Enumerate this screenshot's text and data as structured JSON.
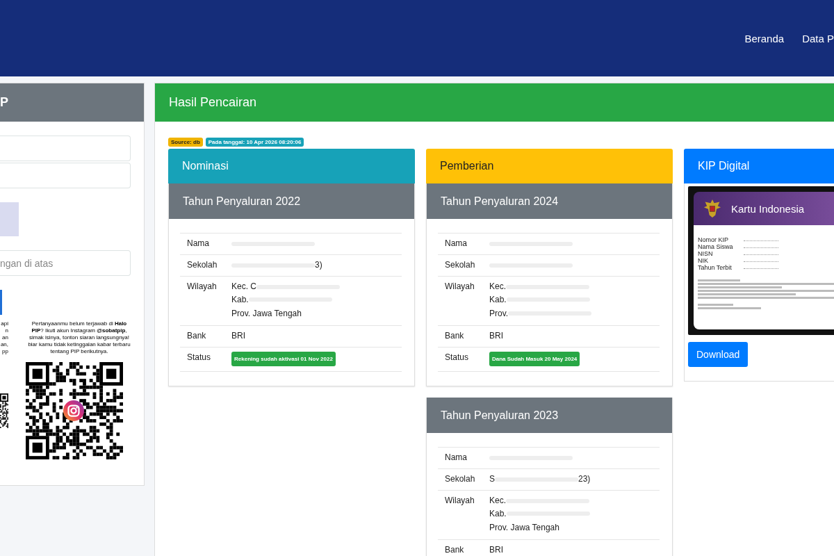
{
  "navbar": {
    "links": [
      "Beranda",
      "Data P"
    ]
  },
  "left_panel": {
    "title": "P",
    "inputs": [
      {
        "kind": "input"
      },
      {
        "kind": "input"
      },
      {
        "kind": "captcha"
      },
      {
        "kind": "input",
        "placeholder": "ngan di atas"
      }
    ],
    "left_text_lines": [
      "api",
      "n",
      "an",
      "an,",
      "pp"
    ],
    "right_text": "Pertanyaanmu belum terjawab di **Halo PIP**? Ikuti akun Instagram **@sobatpip**, simak isinya, tonton siaran langsungnya! biar kamu tidak ketinggalan kabar terbaru tentang PIP berikutnya."
  },
  "results": {
    "title": "Hasil Pencairan",
    "badges": [
      {
        "text": "Source: db",
        "color": "#f0b400"
      },
      {
        "text": "Pada tanggal: 10 Apr 2026 08:20:06",
        "color": "#17a2b8"
      }
    ],
    "columns": [
      {
        "kind": "table",
        "title": "Nominasi",
        "color": "#17a2b8",
        "cards": [
          {
            "title": "Tahun Penyaluran 2022",
            "rows": [
              {
                "label": "Nama",
                "lines": [
                  [
                    {
                      "kind": "blur"
                    }
                  ]
                ]
              },
              {
                "label": "Sekolah",
                "lines": [
                  [
                    {
                      "kind": "blur"
                    },
                    {
                      "kind": "text",
                      "text": "3)"
                    }
                  ]
                ]
              },
              {
                "label": "Wilayah",
                "lines": [
                  [
                    {
                      "kind": "text",
                      "text": "Kec. C"
                    },
                    {
                      "kind": "blur"
                    }
                  ],
                  [
                    {
                      "kind": "text",
                      "text": "Kab. "
                    },
                    {
                      "kind": "blur"
                    }
                  ],
                  [
                    {
                      "kind": "text",
                      "text": "Prov. Jawa Tengah"
                    }
                  ]
                ]
              },
              {
                "label": "Bank",
                "lines": [
                  [
                    {
                      "kind": "text",
                      "text": "BRI"
                    }
                  ]
                ]
              },
              {
                "label": "Status",
                "lines": [
                  [
                    {
                      "kind": "badge",
                      "text": "Rekening sudah aktivasi 01 Nov 2022"
                    }
                  ]
                ]
              }
            ]
          }
        ]
      },
      {
        "kind": "table",
        "title": "Pemberian",
        "color": "#ffc107",
        "cards": [
          {
            "title": "Tahun Penyaluran 2024",
            "rows": [
              {
                "label": "Nama",
                "lines": [
                  [
                    {
                      "kind": "blur"
                    }
                  ]
                ]
              },
              {
                "label": "Sekolah",
                "lines": [
                  [
                    {
                      "kind": "blur"
                    }
                  ]
                ]
              },
              {
                "label": "Wilayah",
                "lines": [
                  [
                    {
                      "kind": "text",
                      "text": "Kec. "
                    },
                    {
                      "kind": "blur"
                    }
                  ],
                  [
                    {
                      "kind": "text",
                      "text": "Kab. "
                    },
                    {
                      "kind": "blur"
                    }
                  ],
                  [
                    {
                      "kind": "text",
                      "text": "Prov. "
                    },
                    {
                      "kind": "blur"
                    }
                  ]
                ]
              },
              {
                "label": "Bank",
                "lines": [
                  [
                    {
                      "kind": "text",
                      "text": "BRI"
                    }
                  ]
                ]
              },
              {
                "label": "Status",
                "lines": [
                  [
                    {
                      "kind": "badge",
                      "text": "Dana Sudah Masuk 20 May 2024"
                    }
                  ]
                ]
              }
            ]
          },
          {
            "title": "Tahun Penyaluran 2023",
            "rows": [
              {
                "label": "Nama",
                "lines": [
                  [
                    {
                      "kind": "blur"
                    }
                  ]
                ]
              },
              {
                "label": "Sekolah",
                "lines": [
                  [
                    {
                      "kind": "text",
                      "text": "S"
                    },
                    {
                      "kind": "blur"
                    },
                    {
                      "kind": "text",
                      "text": "23)"
                    }
                  ]
                ]
              },
              {
                "label": "Wilayah",
                "lines": [
                  [
                    {
                      "kind": "text",
                      "text": "Kec. "
                    },
                    {
                      "kind": "blur"
                    }
                  ],
                  [
                    {
                      "kind": "text",
                      "text": "Kab. "
                    },
                    {
                      "kind": "blur"
                    }
                  ],
                  [
                    {
                      "kind": "text",
                      "text": "Prov. Jawa Tengah"
                    }
                  ]
                ]
              },
              {
                "label": "Bank",
                "lines": [
                  [
                    {
                      "kind": "text",
                      "text": "BRI"
                    }
                  ]
                ]
              }
            ]
          }
        ]
      },
      {
        "kind": "kip",
        "title": "KIP Digital",
        "color": "#007bff",
        "card": {
          "title": "Kartu Indonesia",
          "fields": [
            "Nomor KIP",
            "Nama Siswa",
            "NISN",
            "NIK",
            "Tahun Terbit"
          ]
        },
        "button": "Download"
      }
    ]
  }
}
